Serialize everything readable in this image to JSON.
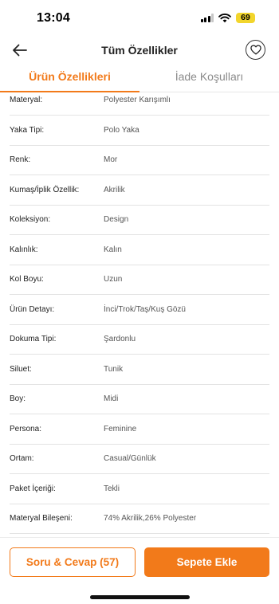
{
  "status_bar": {
    "time": "13:04",
    "battery": "69"
  },
  "nav": {
    "title": "Tüm Özellikler"
  },
  "tabs": [
    {
      "label": "Ürün Özellikleri",
      "active": true
    },
    {
      "label": "İade Koşulları",
      "active": false
    }
  ],
  "specs": [
    {
      "label": "Materyal:",
      "value": "Polyester Karışımlı"
    },
    {
      "label": "Yaka Tipi:",
      "value": "Polo Yaka"
    },
    {
      "label": "Renk:",
      "value": "Mor"
    },
    {
      "label": "Kumaş/İplik Özellik:",
      "value": "Akrilik"
    },
    {
      "label": "Koleksiyon:",
      "value": "Design"
    },
    {
      "label": "Kalınlık:",
      "value": "Kalın"
    },
    {
      "label": "Kol Boyu:",
      "value": "Uzun"
    },
    {
      "label": "Ürün Detayı:",
      "value": "İnci/Trok/Taş/Kuş Gözü"
    },
    {
      "label": "Dokuma Tipi:",
      "value": "Şardonlu"
    },
    {
      "label": "Siluet:",
      "value": "Tunik"
    },
    {
      "label": "Boy:",
      "value": "Midi"
    },
    {
      "label": "Persona:",
      "value": "Feminine"
    },
    {
      "label": "Ortam:",
      "value": "Casual/Günlük"
    },
    {
      "label": "Paket İçeriği:",
      "value": "Tekli"
    },
    {
      "label": "Materyal Bileşeni:",
      "value": "74% Akrilik,26% Polyester"
    }
  ],
  "bottom": {
    "qa_label": "Soru & Cevap (57)",
    "cart_label": "Sepete Ekle"
  },
  "colors": {
    "accent": "#f27a1a"
  },
  "icons": [
    "back-arrow-icon",
    "heart-icon",
    "signal-icon",
    "wifi-icon",
    "battery-icon"
  ]
}
